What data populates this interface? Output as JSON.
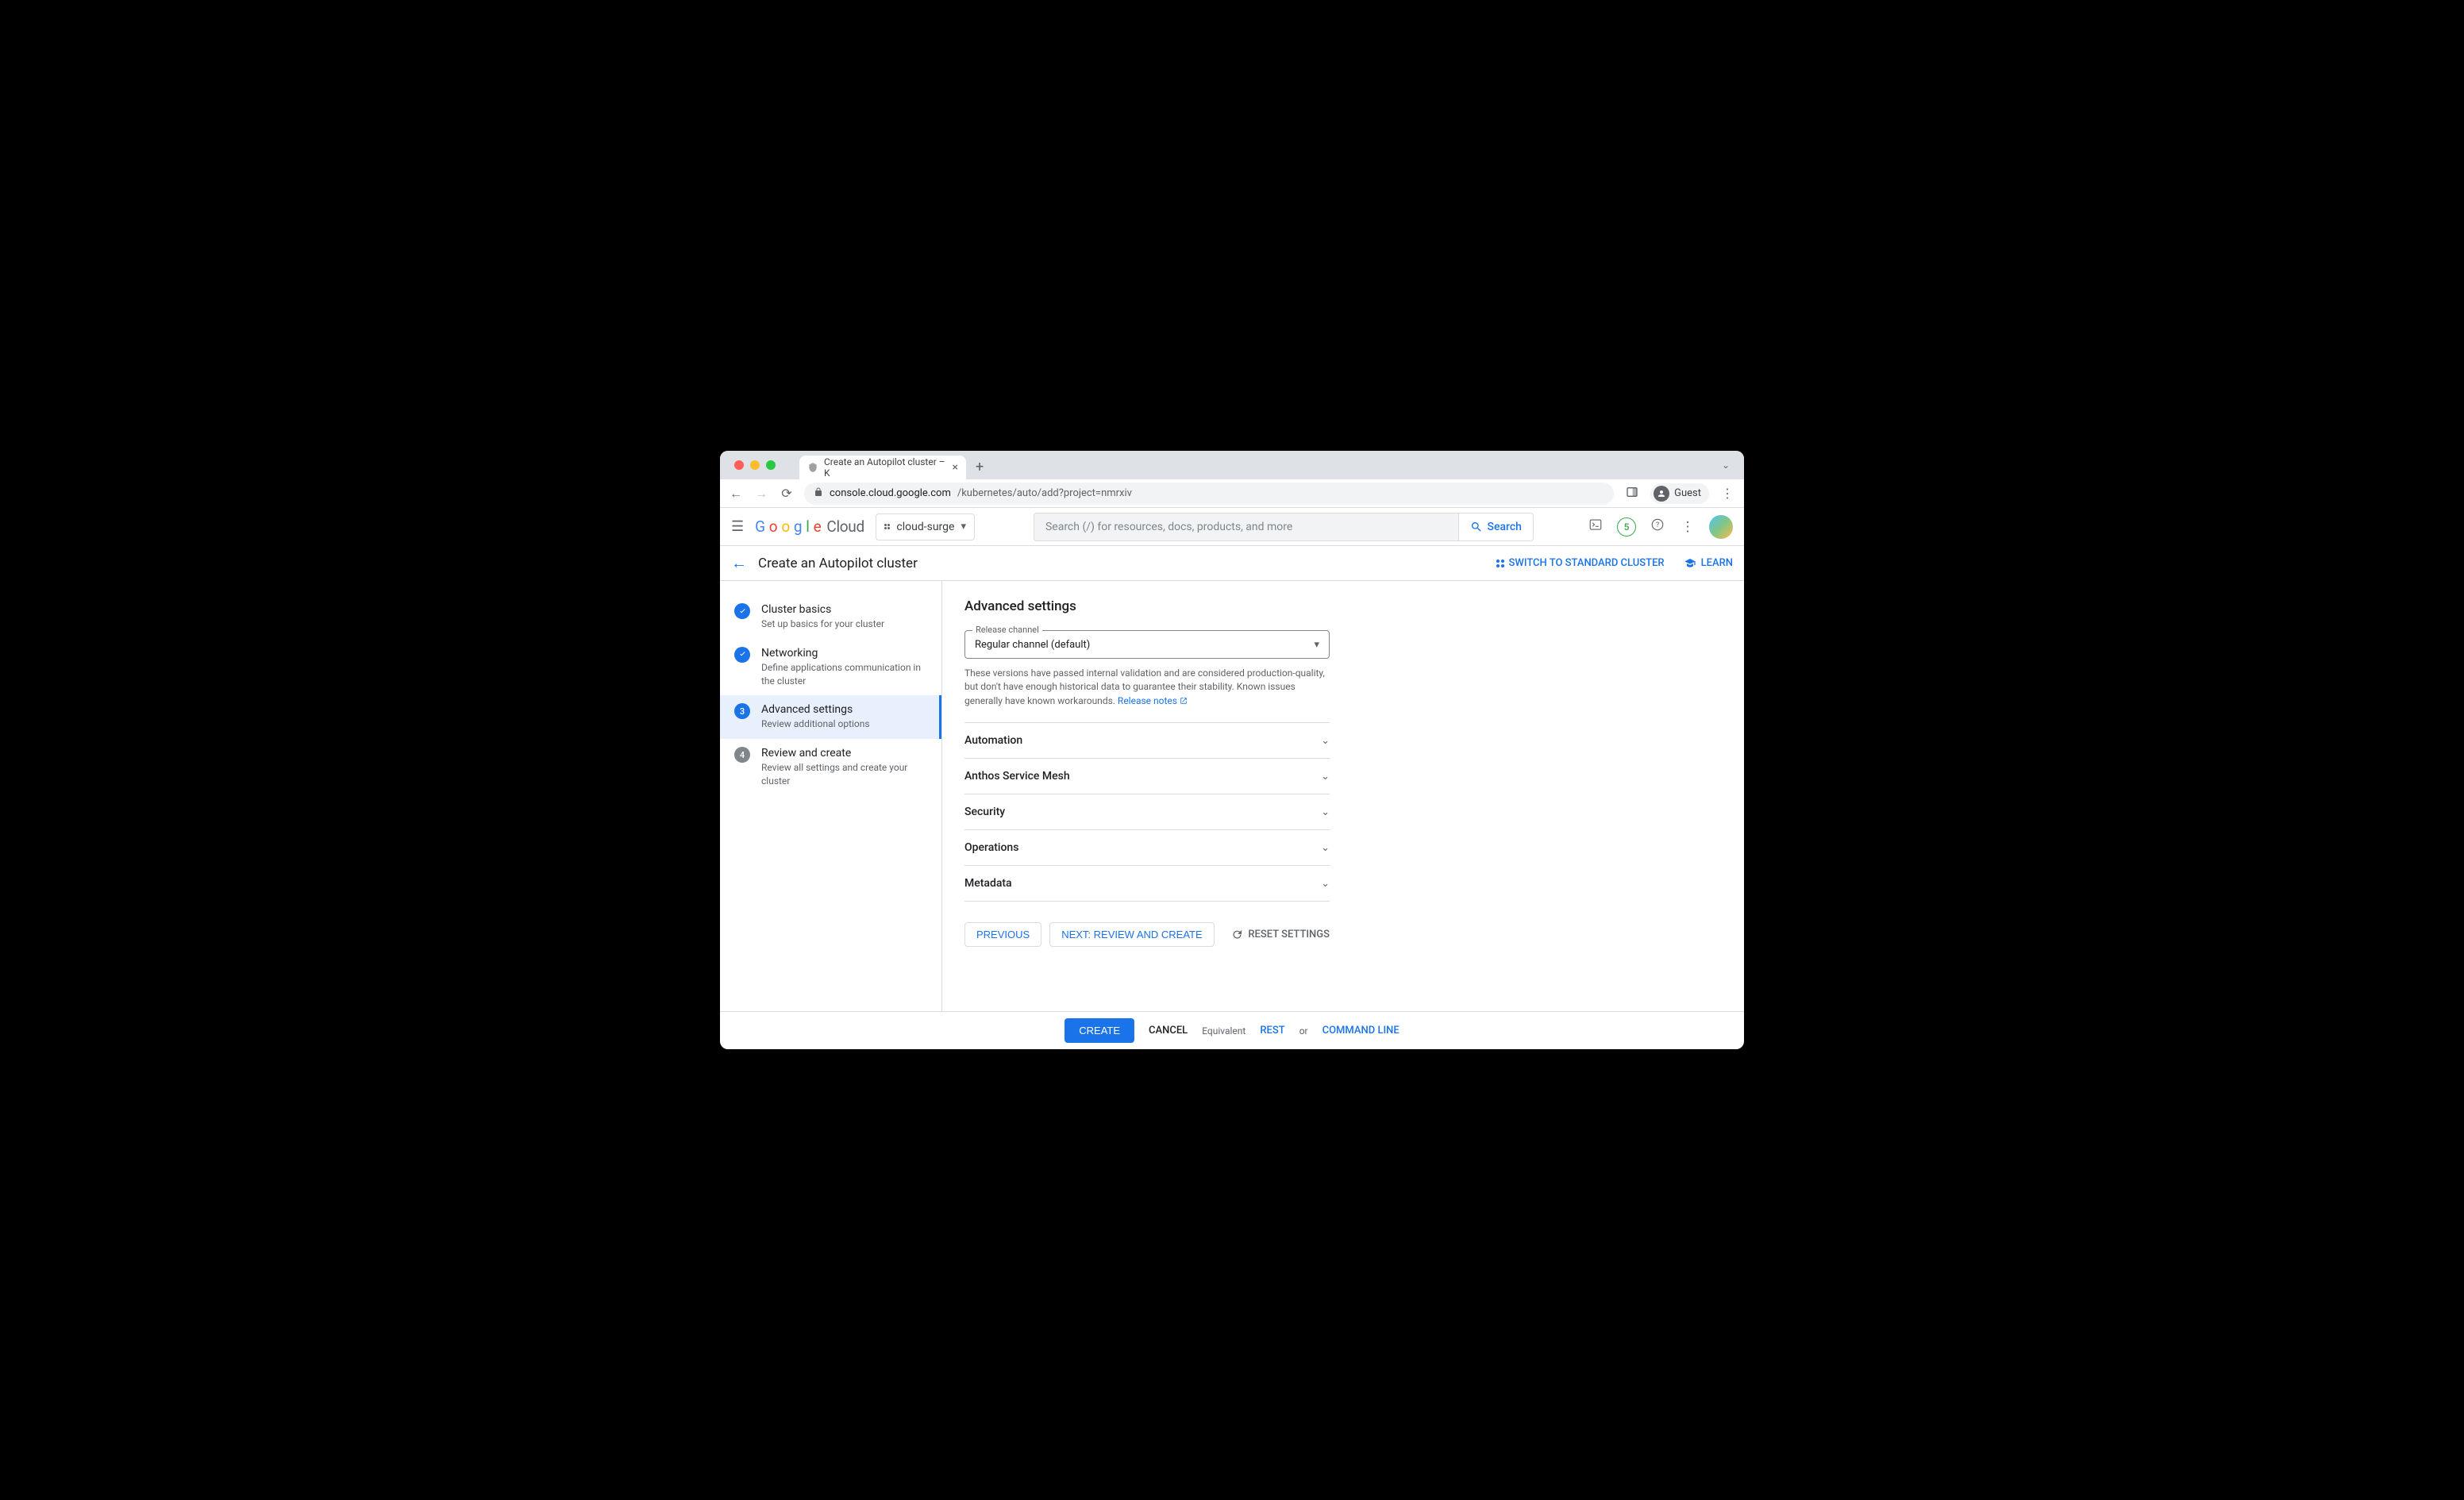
{
  "browser": {
    "tab_title": "Create an Autopilot cluster – K",
    "url_host": "console.cloud.google.com",
    "url_path": "/kubernetes/auto/add?project=nmrxiv",
    "guest_label": "Guest"
  },
  "header": {
    "logo_cloud": "Cloud",
    "project_name": "cloud-surge",
    "search_placeholder": "Search (/) for resources, docs, products, and more",
    "search_button": "Search",
    "trial_count": "5"
  },
  "pagebar": {
    "title": "Create an Autopilot cluster",
    "switch_label": "SWITCH TO STANDARD CLUSTER",
    "learn_label": "LEARN"
  },
  "sidebar": {
    "steps": [
      {
        "title": "Cluster basics",
        "sub": "Set up basics for your cluster",
        "state": "done",
        "num": "✓"
      },
      {
        "title": "Networking",
        "sub": "Define applications communication in the cluster",
        "state": "done",
        "num": "✓"
      },
      {
        "title": "Advanced settings",
        "sub": "Review additional options",
        "state": "current",
        "num": "3"
      },
      {
        "title": "Review and create",
        "sub": "Review all settings and create your cluster",
        "state": "pending",
        "num": "4"
      }
    ]
  },
  "main": {
    "heading": "Advanced settings",
    "release_label": "Release channel",
    "release_value": "Regular channel (default)",
    "helper_text_1": "These versions have passed internal validation and are considered production-quality, but don't have enough historical data to guarantee their stability. Known issues generally have known workarounds. ",
    "release_notes_link": "Release notes",
    "accordion": [
      "Automation",
      "Anthos Service Mesh",
      "Security",
      "Operations",
      "Metadata"
    ],
    "previous_btn": "PREVIOUS",
    "next_btn": "NEXT: REVIEW AND CREATE",
    "reset_btn": "RESET SETTINGS"
  },
  "footer": {
    "create": "CREATE",
    "cancel": "CANCEL",
    "equivalent": "Equivalent",
    "rest": "REST",
    "or": "or",
    "cmdline": "COMMAND LINE"
  }
}
